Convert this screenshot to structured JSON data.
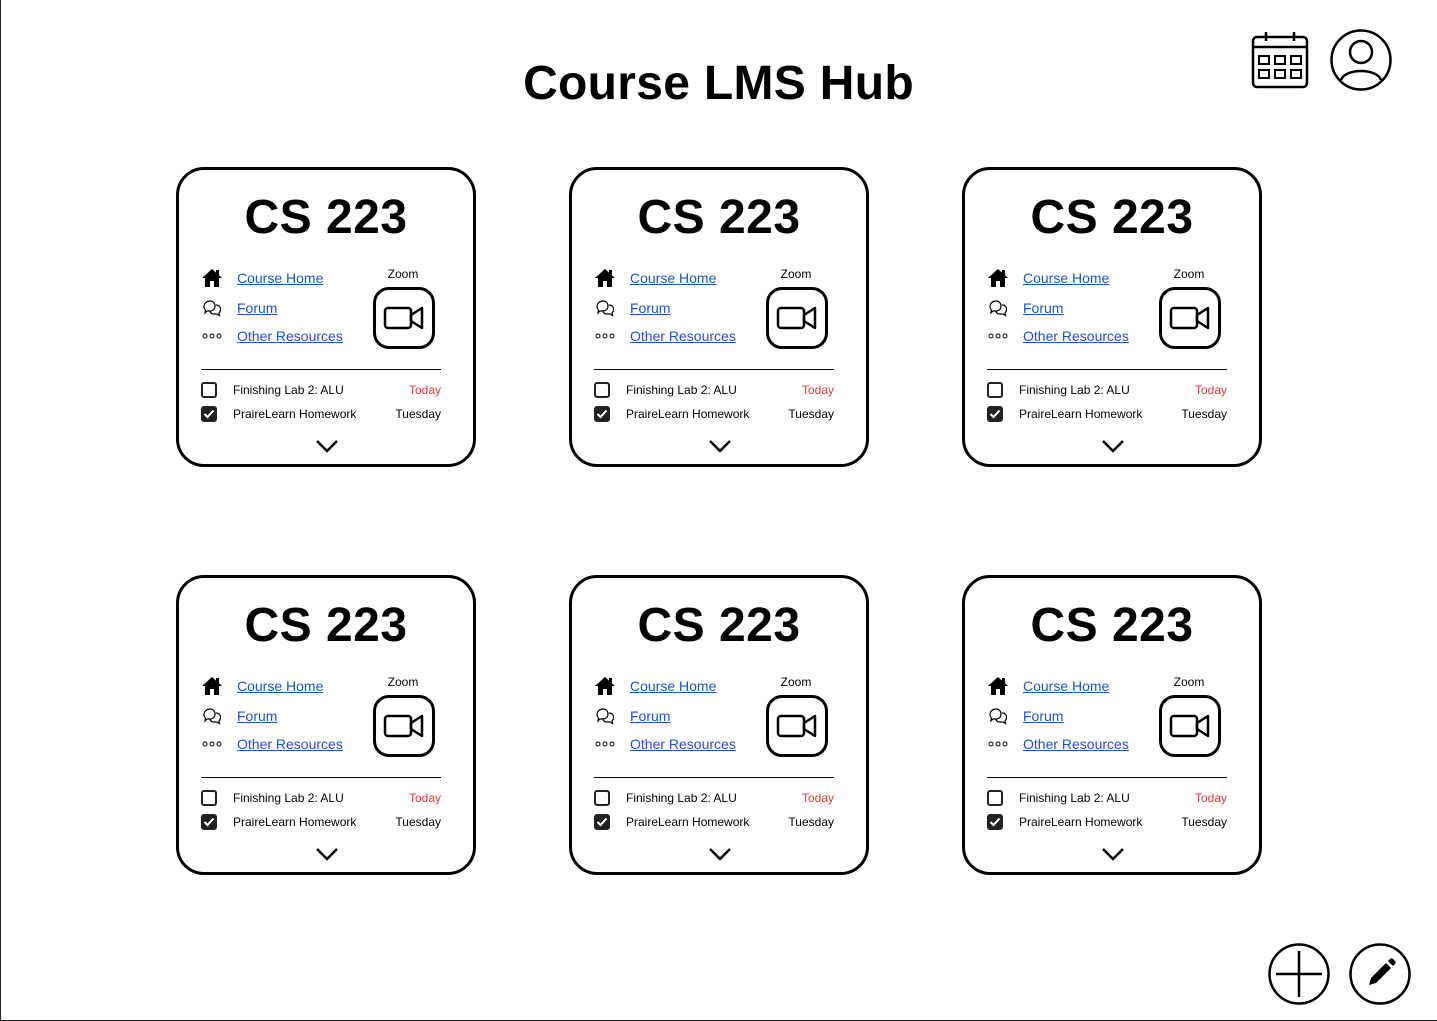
{
  "header": {
    "title": "Course LMS Hub"
  },
  "top_icons": {
    "calendar": "calendar-icon",
    "profile": "user-profile-icon"
  },
  "courses": [
    {
      "title": "CS 223",
      "links": {
        "home": "Course Home",
        "forum": "Forum",
        "other": "Other Resources"
      },
      "zoom_label": "Zoom",
      "tasks": [
        {
          "name": "Finishing Lab 2: ALU",
          "due": "Today",
          "done": false
        },
        {
          "name": "PraireLearn Homework",
          "due": "Tuesday",
          "done": true
        }
      ]
    },
    {
      "title": "CS 223",
      "links": {
        "home": "Course Home",
        "forum": "Forum",
        "other": "Other Resources"
      },
      "zoom_label": "Zoom",
      "tasks": [
        {
          "name": "Finishing Lab 2: ALU",
          "due": "Today",
          "done": false
        },
        {
          "name": "PraireLearn Homework",
          "due": "Tuesday",
          "done": true
        }
      ]
    },
    {
      "title": "CS 223",
      "links": {
        "home": "Course Home",
        "forum": "Forum",
        "other": "Other Resources"
      },
      "zoom_label": "Zoom",
      "tasks": [
        {
          "name": "Finishing Lab 2: ALU",
          "due": "Today",
          "done": false
        },
        {
          "name": "PraireLearn Homework",
          "due": "Tuesday",
          "done": true
        }
      ]
    },
    {
      "title": "CS 223",
      "links": {
        "home": "Course Home",
        "forum": "Forum",
        "other": "Other Resources"
      },
      "zoom_label": "Zoom",
      "tasks": [
        {
          "name": "Finishing Lab 2: ALU",
          "due": "Today",
          "done": false
        },
        {
          "name": "PraireLearn Homework",
          "due": "Tuesday",
          "done": true
        }
      ]
    },
    {
      "title": "CS 223",
      "links": {
        "home": "Course Home",
        "forum": "Forum",
        "other": "Other Resources"
      },
      "zoom_label": "Zoom",
      "tasks": [
        {
          "name": "Finishing Lab 2: ALU",
          "due": "Today",
          "done": false
        },
        {
          "name": "PraireLearn Homework",
          "due": "Tuesday",
          "done": true
        }
      ]
    },
    {
      "title": "CS 223",
      "links": {
        "home": "Course Home",
        "forum": "Forum",
        "other": "Other Resources"
      },
      "zoom_label": "Zoom",
      "tasks": [
        {
          "name": "Finishing Lab 2: ALU",
          "due": "Today",
          "done": false
        },
        {
          "name": "PraireLearn Homework",
          "due": "Tuesday",
          "done": true
        }
      ]
    }
  ],
  "colors": {
    "link": "#1a56c7",
    "due_today": "#e03b3b",
    "border": "#000000"
  },
  "fabs": {
    "add": "plus-icon",
    "edit": "pencil-icon"
  }
}
